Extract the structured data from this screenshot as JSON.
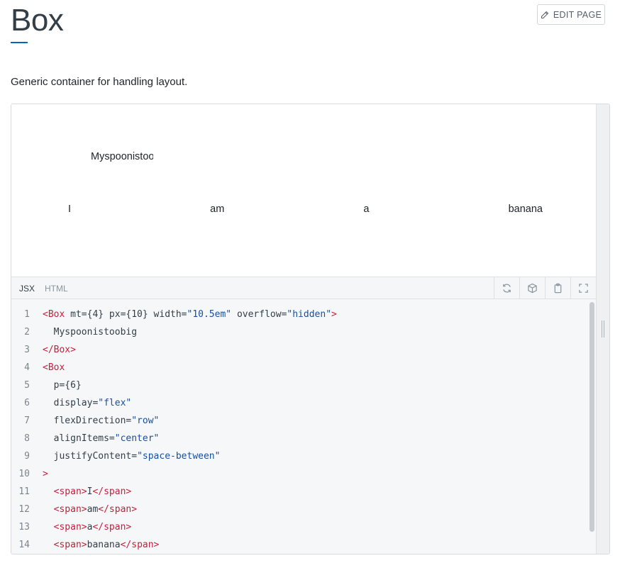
{
  "page": {
    "title": "Box",
    "edit_label": "EDIT PAGE",
    "description": "Generic container for handling layout."
  },
  "preview": {
    "box1_text": "Myspoonistoobig",
    "flex_items": [
      "I",
      "am",
      "a",
      "banana"
    ]
  },
  "editor": {
    "tabs": [
      "JSX",
      "HTML"
    ],
    "active_tab": "JSX",
    "tools": [
      "refresh-icon",
      "cube-icon",
      "clipboard-icon",
      "fullscreen-icon"
    ],
    "lines": [
      {
        "n": "1",
        "tokens": [
          [
            "tag",
            "<Box"
          ],
          [
            "attr",
            " mt={4} px={10} width="
          ],
          [
            "str",
            "\"10.5em\""
          ],
          [
            "attr",
            " overflow="
          ],
          [
            "str",
            "\"hidden\""
          ],
          [
            "tag",
            ">"
          ]
        ]
      },
      {
        "n": "2",
        "tokens": [
          [
            "attr",
            "  Myspoonistoobig"
          ]
        ]
      },
      {
        "n": "3",
        "tokens": [
          [
            "tag",
            "</Box>"
          ]
        ]
      },
      {
        "n": "4",
        "tokens": [
          [
            "tag",
            "<Box"
          ]
        ]
      },
      {
        "n": "5",
        "tokens": [
          [
            "attr",
            "  p={6}"
          ]
        ]
      },
      {
        "n": "6",
        "tokens": [
          [
            "attr",
            "  display="
          ],
          [
            "str",
            "\"flex\""
          ]
        ]
      },
      {
        "n": "7",
        "tokens": [
          [
            "attr",
            "  flexDirection="
          ],
          [
            "str",
            "\"row\""
          ]
        ]
      },
      {
        "n": "8",
        "tokens": [
          [
            "attr",
            "  alignItems="
          ],
          [
            "str",
            "\"center\""
          ]
        ]
      },
      {
        "n": "9",
        "tokens": [
          [
            "attr",
            "  justifyContent="
          ],
          [
            "str",
            "\"space-between\""
          ]
        ]
      },
      {
        "n": "10",
        "tokens": [
          [
            "tag",
            ">"
          ]
        ]
      },
      {
        "n": "11",
        "tokens": [
          [
            "tag",
            "  <span>"
          ],
          [
            "attr",
            "I"
          ],
          [
            "tag",
            "</span>"
          ]
        ]
      },
      {
        "n": "12",
        "tokens": [
          [
            "tag",
            "  <span>"
          ],
          [
            "attr",
            "am"
          ],
          [
            "tag",
            "</span>"
          ]
        ]
      },
      {
        "n": "13",
        "tokens": [
          [
            "tag",
            "  <span>"
          ],
          [
            "attr",
            "a"
          ],
          [
            "tag",
            "</span>"
          ]
        ]
      },
      {
        "n": "14",
        "tokens": [
          [
            "tag",
            "  <span>"
          ],
          [
            "attr",
            "banana"
          ],
          [
            "tag",
            "</span>"
          ]
        ]
      }
    ]
  },
  "colors": {
    "accent": "#0067b8",
    "tag": "#c4203a",
    "string": "#1a4fa0"
  }
}
